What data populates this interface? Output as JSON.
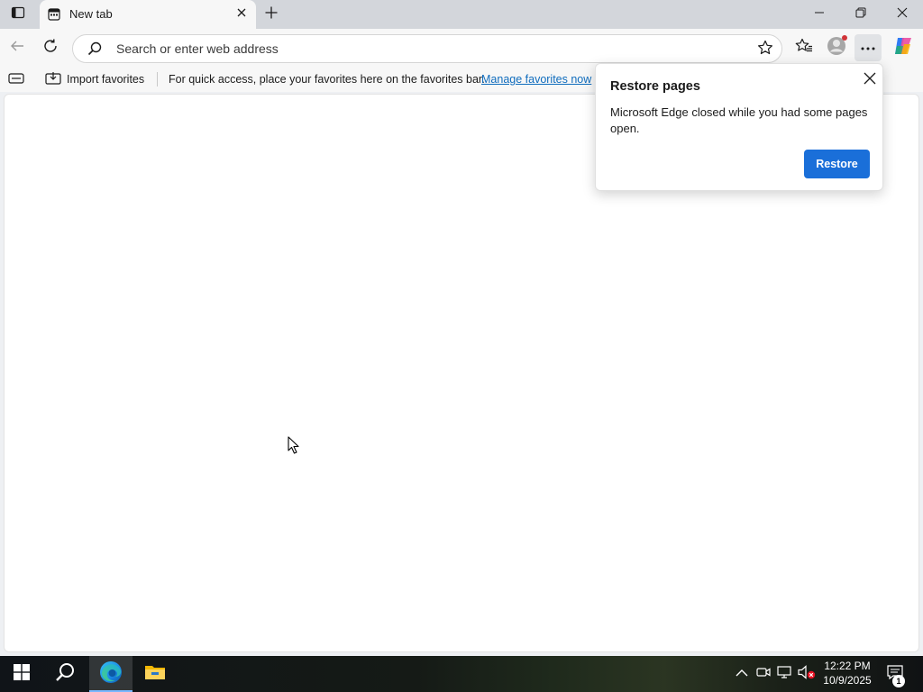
{
  "tabbar": {
    "tab_title": "New tab"
  },
  "toolbar": {
    "address_placeholder": "Search or enter web address"
  },
  "favorites_bar": {
    "import_label": "Import favorites",
    "message": "For quick access, place your favorites here on the favorites bar.",
    "manage_link": "Manage favorites now"
  },
  "restore_popup": {
    "title": "Restore pages",
    "message": "Microsoft Edge closed while you had some pages open.",
    "restore_button": "Restore"
  },
  "taskbar": {
    "time": "12:22 PM",
    "date": "10/9/2025",
    "notification_count": "1"
  },
  "colors": {
    "accent": "#1a6fd9",
    "link": "#0f6cbd",
    "tabbar_bg": "#d3d6db",
    "toolbar_bg": "#f7f7f7"
  },
  "icons": [
    "tab-actions-icon",
    "new-tab-favicon",
    "close-icon",
    "plus-icon",
    "minimize-icon",
    "restore-window-icon",
    "back-arrow-icon",
    "refresh-icon",
    "search-icon",
    "star-icon",
    "favorites-icon",
    "profile-icon",
    "more-icon",
    "copilot-icon",
    "reading-view-icon",
    "import-icon",
    "windows-start-icon",
    "search-taskbar-icon",
    "edge-icon",
    "file-explorer-icon",
    "chevron-up-icon",
    "meet-now-icon",
    "network-icon",
    "volume-muted-icon",
    "notification-icon"
  ]
}
